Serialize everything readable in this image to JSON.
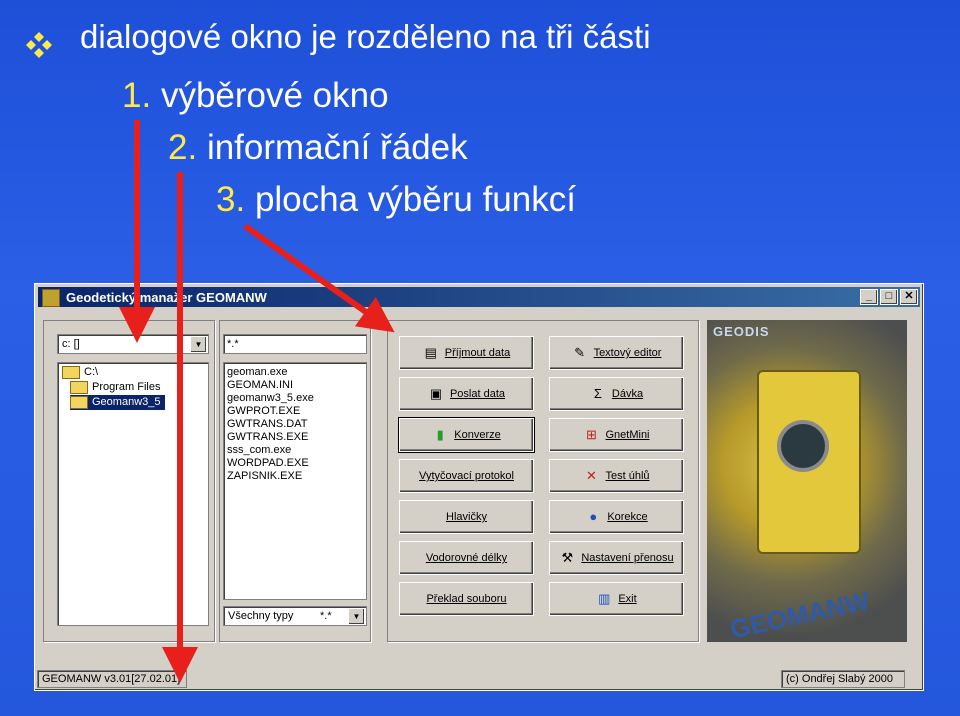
{
  "slide": {
    "title": "dialogové okno je rozděleno na tři části",
    "items": [
      {
        "num": "1.",
        "text": "výběrové okno"
      },
      {
        "num": "2.",
        "text": "informační řádek"
      },
      {
        "num": "3.",
        "text": "plocha výběru funkcí"
      }
    ]
  },
  "colors": {
    "background": "#2457dc",
    "arrow": "#e8201c",
    "bullet": "#ffe94a",
    "number": "#ffe94a"
  },
  "window": {
    "title": "Geodetický manažer GEOMANW",
    "controls": {
      "minimize": "_",
      "maximize": "□",
      "close": "✕"
    },
    "drive_combo": "c: []",
    "filter_input": "*.*",
    "folders": [
      "C:\\",
      "Program Files",
      "Geomanw3_5"
    ],
    "files": [
      "geoman.exe",
      "GEOMAN.INI",
      "geomanw3_5.exe",
      "GWPROT.EXE",
      "GWTRANS.DAT",
      "GWTRANS.EXE",
      "sss_com.exe",
      "WORDPAD.EXE",
      "ZAPISNIK.EXE"
    ],
    "type_combo": "Všechny typy",
    "type_combo_ext": "*.*",
    "buttons_left": [
      "Příjmout data",
      "Poslat data",
      "Konverze",
      "Vytyčovací protokol",
      "Hlavičky",
      "Vodorovné délky",
      "Překlad souboru"
    ],
    "buttons_right": [
      "Textový editor",
      "Dávka",
      "GnetMini",
      "Test úhlů",
      "Korekce",
      "Nastavení přenosu",
      "Exit"
    ],
    "photo_labels": {
      "brand": "GEODIS",
      "product": "GEOMANW"
    },
    "status_left": "GEOMANW v3.01[27.02.01]",
    "status_right": "(c) Ondřej Slabý 2000"
  }
}
